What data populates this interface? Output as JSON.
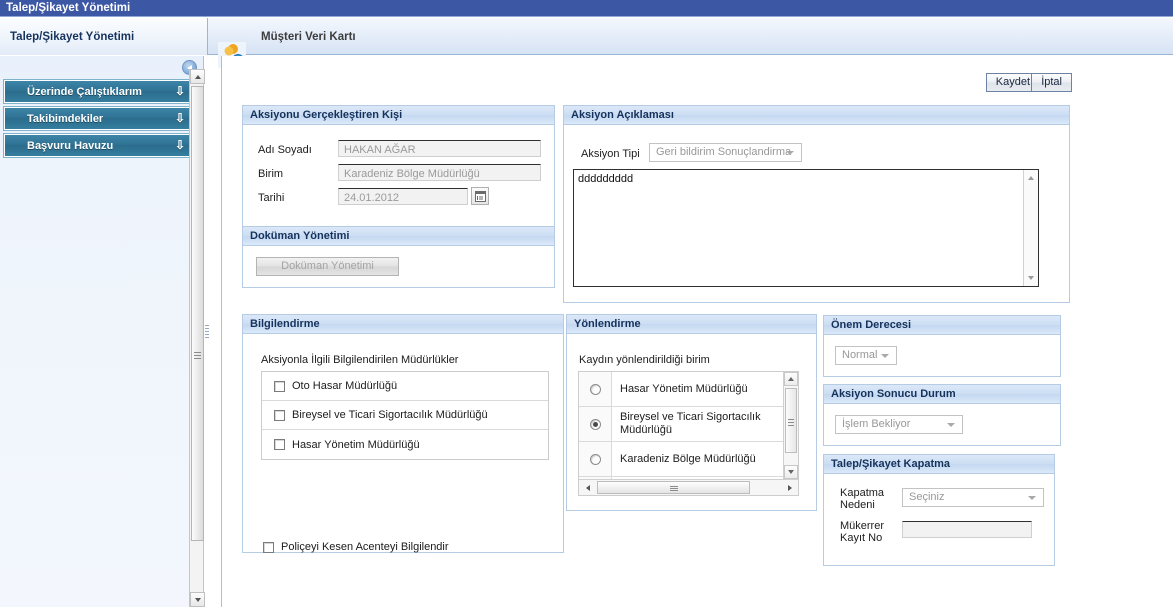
{
  "window": {
    "title": "Talep/Şikayet Yönetimi"
  },
  "tabs": [
    {
      "label": "Talep/Şikayet Yönetimi",
      "active": true
    },
    {
      "label": "Müşteri Veri Kartı",
      "active": false,
      "icon": "customer-card-icon"
    }
  ],
  "sidebar": {
    "collapse_icon": "collapse-left-icon",
    "items": [
      {
        "label": "Üzerinde Çalıştıklarım",
        "chevron": "chevron-down-icon"
      },
      {
        "label": "Takibimdekiler",
        "chevron": "chevron-down-icon"
      },
      {
        "label": "Başvuru Havuzu",
        "chevron": "chevron-down-icon"
      }
    ]
  },
  "toolbar": {
    "save_label": "Kaydet",
    "cancel_label": "İptal"
  },
  "person_panel": {
    "title": "Aksiyonu Gerçekleştiren Kişi",
    "fields": [
      {
        "label": "Adı Soyadı",
        "value": "HAKAN AĞAR"
      },
      {
        "label": "Birim",
        "value": "Karadeniz Bölge Müdürlüğü"
      },
      {
        "label": "Tarihi",
        "value": "24.01.2012",
        "icon": "calendar-icon"
      }
    ]
  },
  "document_panel": {
    "title": "Doküman Yönetimi",
    "button_label": "Doküman Yönetimi"
  },
  "action_panel": {
    "title": "Aksiyon Açıklaması",
    "type_label": "Aksiyon Tipi",
    "type_value": "Geri bildirim Sonuçlandirma",
    "description_value": "ddddddddd",
    "scroll_up_icon": "scroll-up-icon",
    "scroll_down_icon": "scroll-down-icon"
  },
  "info_panel": {
    "title": "Bilgilendirme",
    "list_label": "Aksiyonla İlgili Bilgilendirilen Müdürlükler",
    "options": [
      {
        "label": "Oto Hasar Müdürlüğü",
        "checked": false
      },
      {
        "label": "Bireysel ve Ticari Sigortacılık Müdürlüğü",
        "checked": false
      },
      {
        "label": "Hasar Yönetim Müdürlüğü",
        "checked": false
      }
    ],
    "agency_option": {
      "label": "Poliçeyi Kesen Acenteyi Bilgilendir",
      "checked": false
    }
  },
  "routing_panel": {
    "title": "Yönlendirme",
    "list_label": "Kaydın yönlendirildiği birim",
    "options": [
      {
        "label": "Hasar Yönetim Müdürlüğü",
        "selected": false
      },
      {
        "label": "Bireysel ve Ticari Sigortacılık Müdürlüğü",
        "selected": true
      },
      {
        "label": "Karadeniz Bölge Müdürlüğü",
        "selected": false
      }
    ]
  },
  "priority_panel": {
    "title": "Önem Derecesi",
    "value": "Normal"
  },
  "status_panel": {
    "title": "Aksiyon Sonucu Durum",
    "value": "İşlem Bekliyor"
  },
  "closing_panel": {
    "title": "Talep/Şikayet Kapatma",
    "reason_label_line1": "Kapatma",
    "reason_label_line2": "Nedeni",
    "reason_value": "Seçiniz",
    "duplicate_label_line1": "Mükerrer",
    "duplicate_label_line2": "Kayıt No",
    "duplicate_value": ""
  }
}
